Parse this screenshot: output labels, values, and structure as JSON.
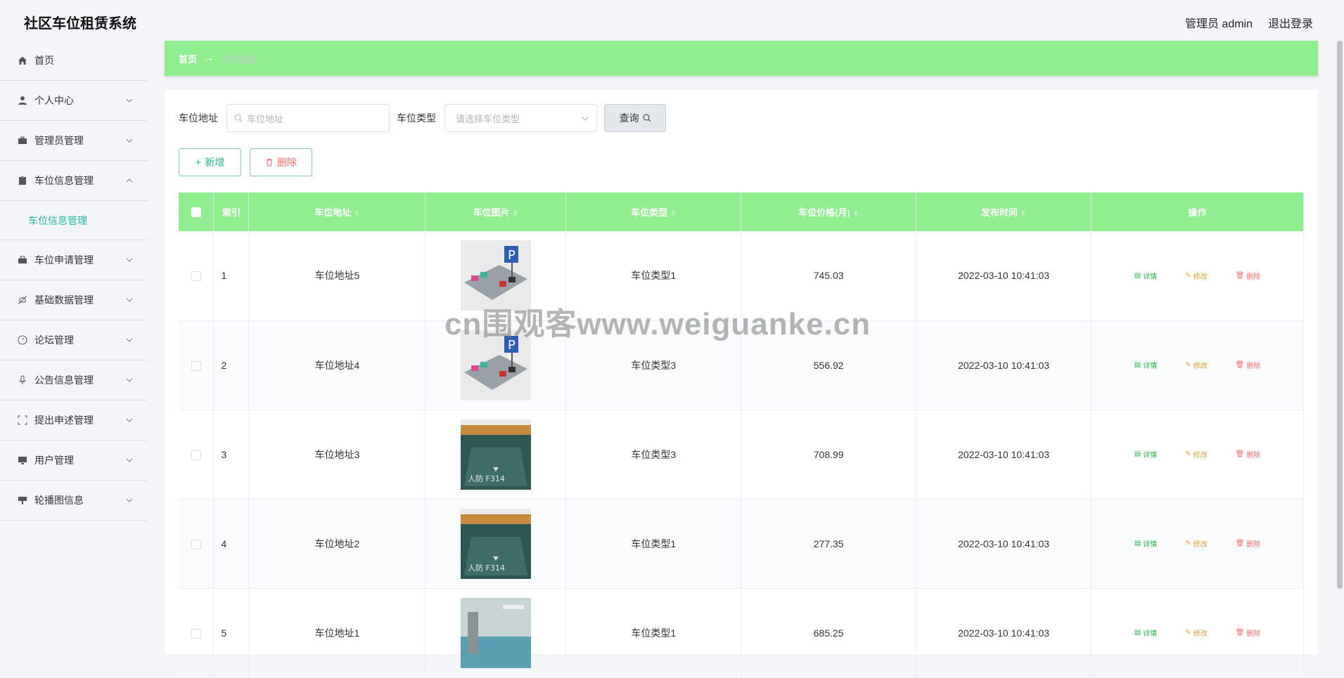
{
  "app": {
    "title": "社区车位租赁系统",
    "user": "管理员 admin",
    "logout": "退出登录"
  },
  "sidebar": {
    "items": [
      {
        "label": "首页",
        "icon": "home-icon",
        "expandable": false
      },
      {
        "label": "个人中心",
        "icon": "user-icon",
        "expandable": true
      },
      {
        "label": "管理员管理",
        "icon": "briefcase-icon",
        "expandable": true
      },
      {
        "label": "车位信息管理",
        "icon": "clipboard-icon",
        "expandable": true,
        "expanded": true
      },
      {
        "label": "车位申请管理",
        "icon": "suitcase-icon",
        "expandable": true
      },
      {
        "label": "基础数据管理",
        "icon": "bell-off-icon",
        "expandable": true
      },
      {
        "label": "论坛管理",
        "icon": "compass-icon",
        "expandable": true
      },
      {
        "label": "公告信息管理",
        "icon": "microphone-icon",
        "expandable": true
      },
      {
        "label": "提出申述管理",
        "icon": "fullscreen-icon",
        "expandable": true
      },
      {
        "label": "用户管理",
        "icon": "monitor-icon",
        "expandable": true
      },
      {
        "label": "轮播图信息",
        "icon": "projector-icon",
        "expandable": true
      }
    ],
    "submenu_active": "车位信息管理"
  },
  "breadcrumb": {
    "home": "首页",
    "arrow": "→",
    "current": "车位信息"
  },
  "filter": {
    "address_label": "车位地址",
    "address_placeholder": "车位地址",
    "type_label": "车位类型",
    "type_placeholder": "请选择车位类型",
    "query_label": "查询"
  },
  "actions": {
    "add_label": "新增",
    "delete_label": "删除"
  },
  "table": {
    "headers": [
      "索引",
      "车位地址",
      "车位图片",
      "车位类型",
      "车位价格(月)",
      "发布时间",
      "操作"
    ],
    "rows": [
      {
        "index": "1",
        "address": "车位地址5",
        "image": "parking-illustration",
        "type": "车位类型1",
        "price": "745.03",
        "time": "2022-03-10 10:41:03"
      },
      {
        "index": "2",
        "address": "车位地址4",
        "image": "parking-illustration",
        "type": "车位类型3",
        "price": "556.92",
        "time": "2022-03-10 10:41:03"
      },
      {
        "index": "3",
        "address": "车位地址3",
        "image": "parking-photo-green",
        "type": "车位类型3",
        "price": "708.99",
        "time": "2022-03-10 10:41:03"
      },
      {
        "index": "4",
        "address": "车位地址2",
        "image": "parking-photo-green",
        "type": "车位类型1",
        "price": "277.35",
        "time": "2022-03-10 10:41:03"
      },
      {
        "index": "5",
        "address": "车位地址1",
        "image": "parking-photo-blue",
        "type": "车位类型1",
        "price": "685.25",
        "time": "2022-03-10 10:41:03"
      }
    ],
    "op_detail": "详情",
    "op_edit": "修改",
    "op_remove": "删除"
  },
  "watermark": "cn围观客www.weiguanke.cn",
  "colors": {
    "accent": "#90ee90",
    "submenu_active": "#27b3a2",
    "detail": "#27b34a",
    "edit": "#e6a23c",
    "remove": "#f56c6c"
  }
}
